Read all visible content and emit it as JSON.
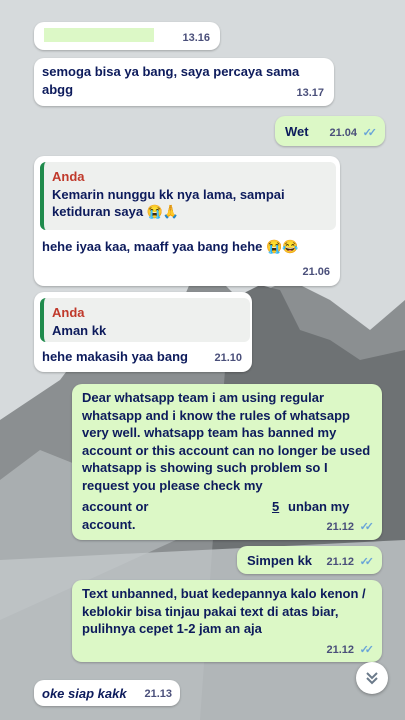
{
  "messages": [
    {
      "id": "m0",
      "text": "",
      "time": "13.16"
    },
    {
      "id": "m1",
      "text": "semoga bisa ya bang, saya percaya sama abgg",
      "time": "13.17"
    },
    {
      "id": "m2",
      "text": "Wet",
      "time": "21.04"
    },
    {
      "id": "m3",
      "quote_author": "Anda",
      "quote_text": "Kemarin nunggu kk nya lama, sampai ketiduran saya 😭🙏",
      "text": "hehe iyaa kaa, maaff yaa bang hehe 😭😂",
      "time": "21.06"
    },
    {
      "id": "m4",
      "quote_author": "Anda",
      "quote_text": "Aman kk",
      "text": "hehe makasih yaa bang",
      "time": "21.10"
    },
    {
      "id": "m5",
      "line1": "Dear whatsapp team i am using regular whatsapp and i know the rules of whatsapp very well. whatsapp team has banned my account or this account can no longer be used whatsapp is showing such problem so I request you please check my",
      "line2a": "account or",
      "line2b": "5",
      "line2c": "unban my",
      "line3": "account.",
      "time": "21.12"
    },
    {
      "id": "m6",
      "text": "Simpen kk",
      "time": "21.12"
    },
    {
      "id": "m7",
      "text": "Text unbanned, buat kedepannya kalo kenon / keblokir bisa tinjau pakai text di atas biar, pulihnya cepet 1-2 jam an aja",
      "time": "21.12"
    },
    {
      "id": "m8",
      "text": "oke siap kakk",
      "time": "21.13"
    }
  ],
  "ticks_glyph": "✓✓",
  "scroll_icon": "chevron-double-down-icon",
  "colors": {
    "outgoing": "#dcf8c6",
    "incoming": "#ffffff",
    "text": "#0d1b5c",
    "quote_author": "#c0392b",
    "ticks": "#6aa5d8"
  }
}
